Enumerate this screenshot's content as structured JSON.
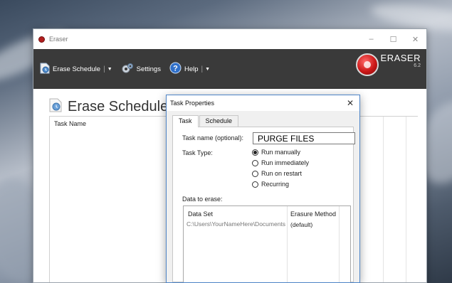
{
  "main_window": {
    "title": "Eraser",
    "controls": {
      "minimize": "–",
      "maximize": "☐",
      "close": "✕"
    }
  },
  "toolbar": {
    "erase_schedule": "Erase Schedule",
    "settings": "Settings",
    "help": "Help",
    "separator": "|",
    "dropdown": "▼"
  },
  "brand": {
    "name": "ERASER",
    "version": "6.2"
  },
  "page": {
    "title": "Erase Schedule",
    "column_task_name": "Task Name"
  },
  "dialog": {
    "title": "Task Properties",
    "close": "✕",
    "tabs": [
      {
        "label": "Task",
        "active": true
      },
      {
        "label": "Schedule",
        "active": false
      }
    ],
    "task_name_label": "Task name (optional):",
    "task_name_value": "PURGE FILES",
    "task_type_label": "Task Type:",
    "task_types": [
      {
        "label": "Run manually",
        "selected": true
      },
      {
        "label": "Run immediately",
        "selected": false
      },
      {
        "label": "Run on restart",
        "selected": false
      },
      {
        "label": "Recurring",
        "selected": false
      }
    ],
    "data_to_erase_label": "Data to erase:",
    "data_table": {
      "headers": {
        "data_set": "Data Set",
        "erasure_method": "Erasure Method"
      },
      "rows": [
        {
          "data_set": "C:\\Users\\YourNameHere\\Documents",
          "erasure_method": "(default)"
        }
      ]
    }
  },
  "colors": {
    "toolbar_bg": "#3a3a3a",
    "dialog_border": "#4d84c7",
    "brand_red": "#cc1818"
  }
}
